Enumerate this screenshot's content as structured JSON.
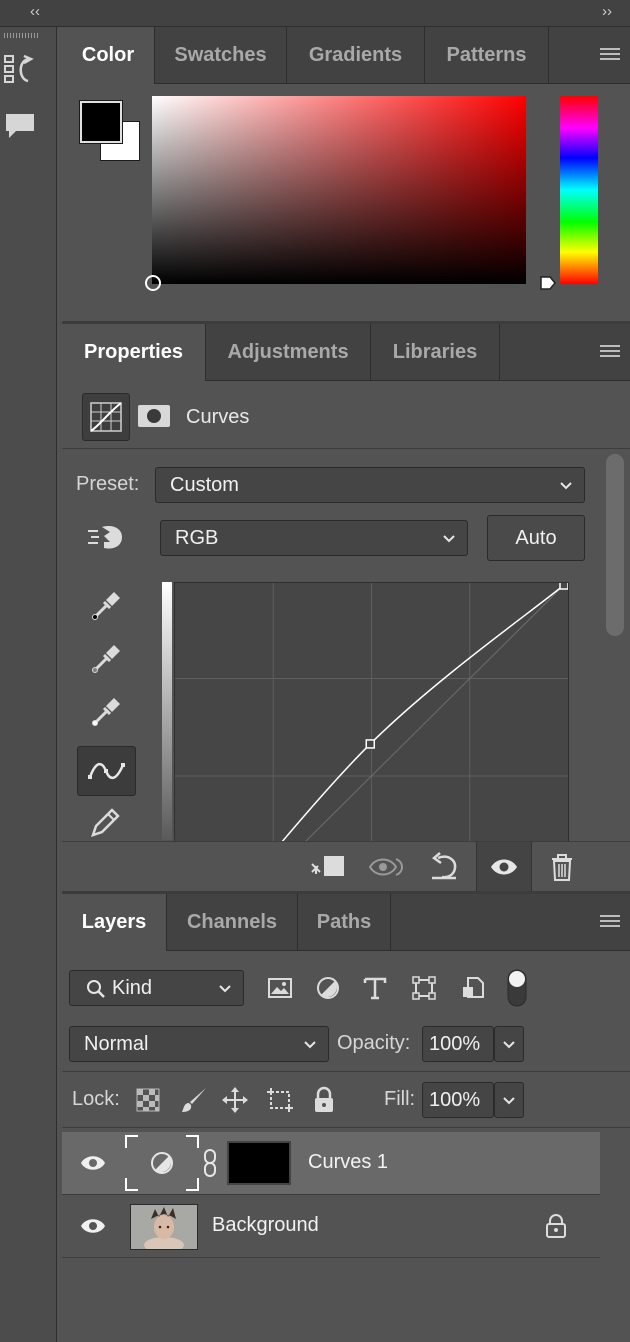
{
  "top_strip": {
    "collapse_left": "‹‹",
    "collapse_right": "››"
  },
  "color_panel": {
    "tabs": [
      "Color",
      "Swatches",
      "Gradients",
      "Patterns"
    ],
    "active_tab": "Color",
    "foreground_color": "#000000",
    "background_color": "#ffffff",
    "picker_hue": "#ff0000"
  },
  "properties_panel": {
    "tabs": [
      "Properties",
      "Adjustments",
      "Libraries"
    ],
    "active_tab": "Properties",
    "adjustment_name": "Curves",
    "preset_label": "Preset:",
    "preset_value": "Custom",
    "channel_value": "RGB",
    "auto_label": "Auto",
    "curve": {
      "type": "line",
      "x_range": [
        0,
        255
      ],
      "y_range": [
        0,
        255
      ],
      "grid": true,
      "points": [
        {
          "x": 0,
          "y": 0
        },
        {
          "x": 128,
          "y": 150
        },
        {
          "x": 255,
          "y": 255
        }
      ]
    }
  },
  "layers_panel": {
    "tabs": [
      "Layers",
      "Channels",
      "Paths"
    ],
    "active_tab": "Layers",
    "filter_kind": "Kind",
    "blend_mode": "Normal",
    "opacity_label": "Opacity:",
    "opacity_value": "100%",
    "lock_label": "Lock:",
    "fill_label": "Fill:",
    "fill_value": "100%",
    "layers": [
      {
        "name": "Curves 1",
        "selected": true,
        "visible": true,
        "icon": "adjustment-icon"
      },
      {
        "name": "Background",
        "selected": false,
        "visible": true,
        "locked": true
      }
    ]
  }
}
